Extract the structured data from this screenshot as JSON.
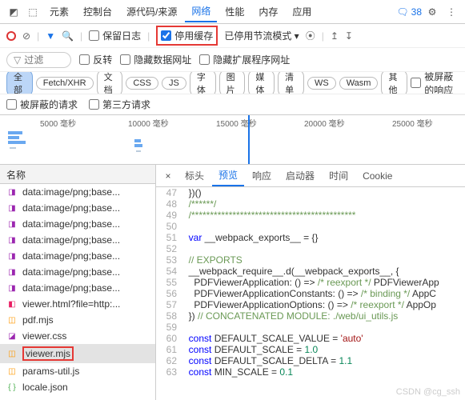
{
  "topbar": {
    "tabs": [
      "元素",
      "控制台",
      "源代码/来源",
      "网络",
      "性能",
      "内存",
      "应用"
    ],
    "active_index": 3,
    "msg_count": "38"
  },
  "toolbar": {
    "preserve_log": "保留日志",
    "disable_cache": "停用缓存",
    "throttle": "已停用节流模式"
  },
  "filter": {
    "placeholder": "过滤",
    "invert": "反转",
    "hide_data_urls": "隐藏数据网址",
    "hide_ext_urls": "隐藏扩展程序网址"
  },
  "types": {
    "all": "全部",
    "items": [
      "Fetch/XHR",
      "文档",
      "CSS",
      "JS",
      "字体",
      "图片",
      "媒体",
      "清单",
      "WS",
      "Wasm",
      "其他"
    ],
    "blocked": "被屏蔽的响应"
  },
  "extra": {
    "blocked_req": "被屏蔽的请求",
    "third_party": "第三方请求"
  },
  "timeline": {
    "ticks": [
      "5000 毫秒",
      "10000 毫秒",
      "15000 毫秒",
      "20000 毫秒",
      "25000 毫秒"
    ]
  },
  "namecol": "名称",
  "files": [
    {
      "icon": "img",
      "label": "data:image/png;base..."
    },
    {
      "icon": "img",
      "label": "data:image/png;base..."
    },
    {
      "icon": "img",
      "label": "data:image/png;base..."
    },
    {
      "icon": "img",
      "label": "data:image/png;base..."
    },
    {
      "icon": "img",
      "label": "data:image/png;base..."
    },
    {
      "icon": "img",
      "label": "data:image/png;base..."
    },
    {
      "icon": "img",
      "label": "data:image/png;base..."
    },
    {
      "icon": "doc",
      "label": "viewer.html?file=http:..."
    },
    {
      "icon": "js",
      "label": "pdf.mjs"
    },
    {
      "icon": "css",
      "label": "viewer.css"
    },
    {
      "icon": "js",
      "label": "viewer.mjs",
      "selected": true
    },
    {
      "icon": "js",
      "label": "params-util.js"
    },
    {
      "icon": "json",
      "label": "locale.json"
    }
  ],
  "detail_tabs": {
    "items": [
      "标头",
      "预览",
      "响应",
      "启动器",
      "时间",
      "Cookie"
    ],
    "active_index": 1
  },
  "code": [
    {
      "n": 47,
      "cls": "",
      "t": "  })()"
    },
    {
      "n": 48,
      "cls": "c-cm",
      "t": "  /******/"
    },
    {
      "n": 49,
      "cls": "c-cm",
      "t": "  /********************************************"
    },
    {
      "n": 50,
      "cls": "",
      "t": ""
    },
    {
      "n": 51,
      "cls": "",
      "t": "  var __webpack_exports__ = {}"
    },
    {
      "n": 52,
      "cls": "",
      "t": ""
    },
    {
      "n": 53,
      "cls": "c-cm",
      "t": "  // EXPORTS"
    },
    {
      "n": 54,
      "cls": "",
      "t": "  __webpack_require__.d(__webpack_exports__, {"
    },
    {
      "n": 55,
      "cls": "",
      "t": "    PDFViewerApplication: () => /* reexport */ PDFViewerApp"
    },
    {
      "n": 56,
      "cls": "",
      "t": "    PDFViewerApplicationConstants: () => /* binding */ AppC"
    },
    {
      "n": 57,
      "cls": "",
      "t": "    PDFViewerApplicationOptions: () => /* reexport */ AppOp"
    },
    {
      "n": 58,
      "cls": "",
      "t": "  }) // CONCATENATED MODULE: ./web/ui_utils.js"
    },
    {
      "n": 59,
      "cls": "",
      "t": ""
    },
    {
      "n": 60,
      "cls": "",
      "t": "  const DEFAULT_SCALE_VALUE = 'auto'"
    },
    {
      "n": 61,
      "cls": "",
      "t": "  const DEFAULT_SCALE = 1.0"
    },
    {
      "n": 62,
      "cls": "",
      "t": "  const DEFAULT_SCALE_DELTA = 1.1"
    },
    {
      "n": 63,
      "cls": "",
      "t": "  const MIN_SCALE = 0.1"
    }
  ],
  "watermark": "CSDN @cg_ssh"
}
